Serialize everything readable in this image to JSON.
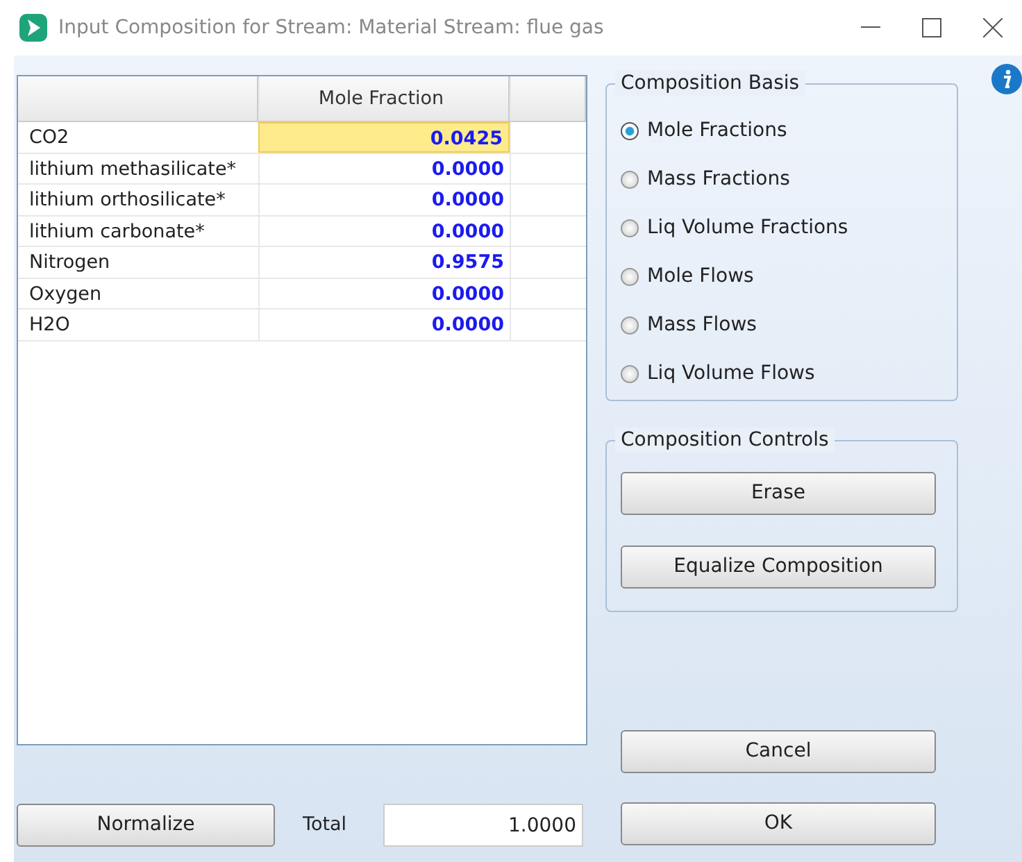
{
  "window": {
    "title": "Input Composition for Stream: Material Stream: flue gas"
  },
  "table": {
    "columns": [
      "Mole Fraction"
    ],
    "rows": [
      {
        "name": "CO2",
        "value": "0.0425",
        "selected": true
      },
      {
        "name": "lithium methasilicate*",
        "value": "0.0000",
        "selected": false
      },
      {
        "name": "lithium orthosilicate*",
        "value": "0.0000",
        "selected": false
      },
      {
        "name": "lithium carbonate*",
        "value": "0.0000",
        "selected": false
      },
      {
        "name": "Nitrogen",
        "value": "0.9575",
        "selected": false
      },
      {
        "name": "Oxygen",
        "value": "0.0000",
        "selected": false
      },
      {
        "name": "H2O",
        "value": "0.0000",
        "selected": false
      }
    ]
  },
  "composition_basis": {
    "title": "Composition Basis",
    "options": [
      {
        "label": "Mole Fractions",
        "selected": true
      },
      {
        "label": "Mass Fractions",
        "selected": false
      },
      {
        "label": "Liq Volume Fractions",
        "selected": false
      },
      {
        "label": "Mole Flows",
        "selected": false
      },
      {
        "label": "Mass Flows",
        "selected": false
      },
      {
        "label": "Liq Volume Flows",
        "selected": false
      }
    ]
  },
  "composition_controls": {
    "title": "Composition Controls",
    "buttons": [
      "Erase",
      "Equalize Composition"
    ]
  },
  "normalize_button": "Normalize",
  "total": {
    "label": "Total",
    "value": "1.0000"
  },
  "dialog_buttons": [
    "Cancel",
    "OK"
  ]
}
